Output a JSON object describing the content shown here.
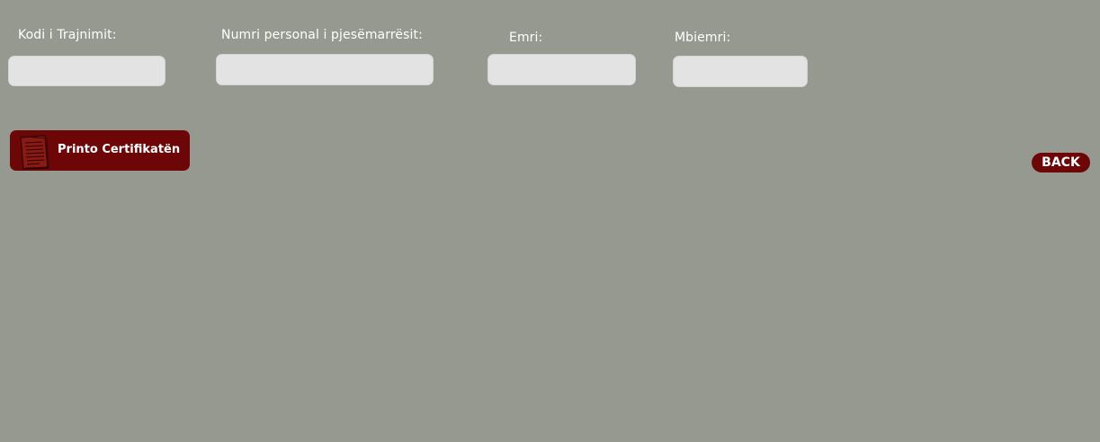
{
  "form": {
    "fields": [
      {
        "label": "Kodi i Trajnimit:",
        "value": "",
        "placeholder": ""
      },
      {
        "label": "Numri personal i pjesëmarrësit:",
        "value": "",
        "placeholder": ""
      },
      {
        "label": "Emri:",
        "value": "",
        "placeholder": ""
      },
      {
        "label": "Mbiemri:",
        "value": "",
        "placeholder": ""
      }
    ]
  },
  "actions": {
    "print_label": "Printo Certifikatën",
    "print_icon": "document-icon",
    "back_label": "BACK"
  },
  "colors": {
    "background": "#969990",
    "button": "#6d0607",
    "field": "#e3e3e3",
    "label_text": "#ffffff"
  }
}
